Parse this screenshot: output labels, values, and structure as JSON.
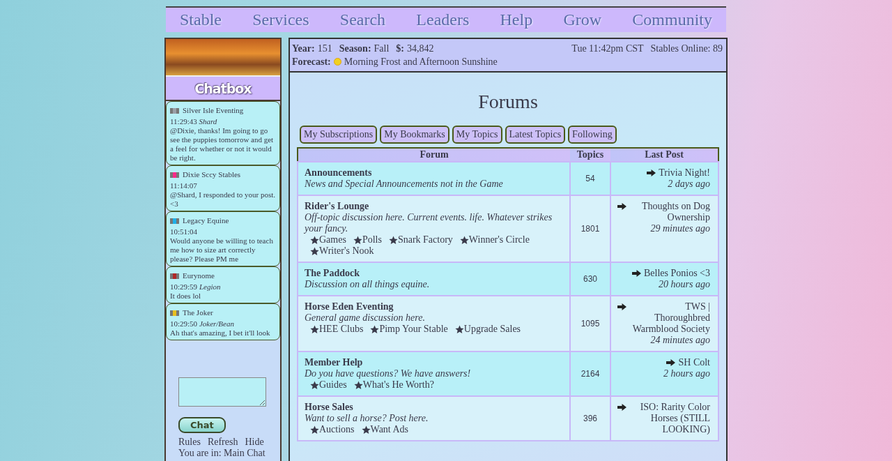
{
  "nav": [
    "Stable",
    "Services",
    "Search",
    "Leaders",
    "Help",
    "Grow",
    "Community"
  ],
  "chatbox": {
    "title": "Chatbox",
    "messages": [
      {
        "user": "Silver Isle Eventing",
        "color": "#9aa0a8",
        "time": "11:29:43",
        "alias": "Shard",
        "text": "@Dixie, thanks! Im going to go see the puppies tomorrow and get a feel for whether or not it would be right."
      },
      {
        "user": "Dixie Sccy Stables",
        "color": "#ff2a8a",
        "time": "11:14:07",
        "text": "@Shard, I responded to your post. <3"
      },
      {
        "user": "Legacy Equine",
        "color": "#20b0e8",
        "time": "10:51:04",
        "text": "Would anyone be willing to teach me how to size art correctly please? Please PM me"
      },
      {
        "user": "Eurynome",
        "color": "#b02828",
        "time": "10:29:59",
        "alias": "Legion",
        "text": "It does lol"
      },
      {
        "user": "The Joker",
        "color": "#e8c020",
        "time": "10:29:50",
        "alias": "Joker/Bean",
        "text": "Ah that's amazing, I bet it'll look"
      }
    ],
    "button": "Chat",
    "links": [
      "Rules",
      "Refresh",
      "Hide"
    ],
    "room": "You are in: Main Chat"
  },
  "status": {
    "year_label": "Year:",
    "year": "151",
    "season_label": "Season:",
    "season": "Fall",
    "money_label": "$:",
    "money": "34,842",
    "time": "Tue 11:42pm CST",
    "online": "Stables Online: 89",
    "forecast_label": "Forecast:",
    "forecast": "Morning Frost and Afternoon Sunshine"
  },
  "title": "Forums",
  "tabs": [
    "My Subscriptions",
    "My Bookmarks",
    "My Topics",
    "Latest Topics",
    "Following"
  ],
  "table": {
    "columns": [
      "Forum",
      "Topics",
      "Last Post"
    ],
    "rows": [
      {
        "name": "Announcements",
        "description": "News and Special Announcements not in the Game",
        "subforums": [],
        "topics": "54",
        "last_post": "Trivia Night!",
        "last_time": "2 days ago"
      },
      {
        "name": "Rider's Lounge",
        "description": "Off-topic discussion here. Current events. life. Whatever strikes your fancy.",
        "subforums": [
          "Games",
          "Polls",
          "Snark Factory",
          "Winner's Circle",
          "Writer's Nook"
        ],
        "topics": "1801",
        "last_post": "Thoughts on Dog Ownership",
        "last_time": "29 minutes ago"
      },
      {
        "name": "The Paddock",
        "description": "Discussion on all things equine.",
        "subforums": [],
        "topics": "630",
        "last_post": "Belles Ponios <3",
        "last_time": "20 hours ago"
      },
      {
        "name": "Horse Eden Eventing",
        "description": "General game discussion here.",
        "subforums": [
          "HEE Clubs",
          "Pimp Your Stable",
          "Upgrade Sales"
        ],
        "topics": "1095",
        "last_post": "TWS | Thoroughbred Warmblood Society",
        "last_time": "24 minutes ago"
      },
      {
        "name": "Member Help",
        "description": "Do you have questions? We have answers!",
        "subforums": [
          "Guides",
          "What's He Worth?"
        ],
        "topics": "2164",
        "last_post": "SH Colt",
        "last_time": "2 hours ago"
      },
      {
        "name": "Horse Sales",
        "description": "Want to sell a horse? Post here.",
        "subforums": [
          "Auctions",
          "Want Ads"
        ],
        "topics": "396",
        "last_post": "ISO: Rarity Color Horses (STILL LOOKING)"
      }
    ]
  }
}
